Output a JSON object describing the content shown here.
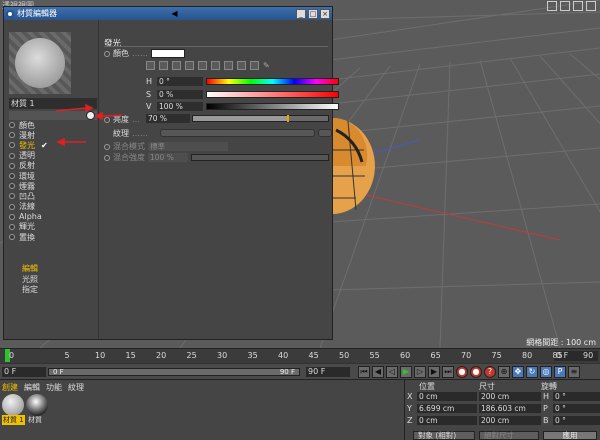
{
  "viewport": {
    "title": "透視視圖",
    "grid_spacing": "網格間距 : 100 cm"
  },
  "material_editor": {
    "title": "材質編輯器",
    "material_name": "材質 1",
    "channels": [
      {
        "label": "顏色",
        "active": false,
        "checked": false
      },
      {
        "label": "漫射",
        "active": false,
        "checked": false
      },
      {
        "label": "發光",
        "active": true,
        "checked": true
      },
      {
        "label": "透明",
        "active": false,
        "checked": false
      },
      {
        "label": "反射",
        "active": false,
        "checked": false
      },
      {
        "label": "環境",
        "active": false,
        "checked": false
      },
      {
        "label": "煙霧",
        "active": false,
        "checked": false
      },
      {
        "label": "凹凸",
        "active": false,
        "checked": false
      },
      {
        "label": "法線",
        "active": false,
        "checked": false
      },
      {
        "label": "Alpha",
        "active": false,
        "checked": false
      },
      {
        "label": "輝光",
        "active": false,
        "checked": false
      },
      {
        "label": "置換",
        "active": false,
        "checked": false
      }
    ],
    "sub_items": [
      {
        "label": "編輯",
        "highlight": true
      },
      {
        "label": "光照",
        "highlight": false
      },
      {
        "label": "指定",
        "highlight": false
      }
    ],
    "section": "發光",
    "color_label": "顏色",
    "color_value": "#ffffff",
    "h_value": "0 °",
    "s_value": "0 %",
    "v_value": "100 %",
    "brightness_label": "亮度",
    "brightness_value": "70 %",
    "brightness_level": 0.7,
    "texture_label": "紋理",
    "blend_mode_label": "混合模式",
    "blend_mode_value": "標準",
    "blend_strength_label": "混合強度",
    "blend_strength_value": "100 %"
  },
  "timeline": {
    "ticks": [
      "0",
      "5",
      "10",
      "15",
      "20",
      "25",
      "30",
      "35",
      "40",
      "45",
      "50",
      "55",
      "60",
      "65",
      "70",
      "75",
      "80",
      "85",
      "90"
    ],
    "current_frame": "0 F"
  },
  "playback": {
    "start": "0 F",
    "range_start": "0 F",
    "range_end": "90 F",
    "end": "90 F"
  },
  "material_manager": {
    "menu": [
      "創建",
      "編輯",
      "功能",
      "紋理"
    ],
    "materials": [
      {
        "label": "材質 1",
        "selected": true
      },
      {
        "label": "材質",
        "selected": false
      }
    ]
  },
  "coordinates": {
    "headers": [
      "位置",
      "尺寸",
      "旋轉"
    ],
    "rows": [
      {
        "axis": "X",
        "pos": "0 cm",
        "size": "200 cm",
        "rot_axis": "H",
        "rot": "0 °"
      },
      {
        "axis": "Y",
        "pos": "6.699 cm",
        "size": "186.603 cm",
        "rot_axis": "P",
        "rot": "0 °"
      },
      {
        "axis": "Z",
        "pos": "0 cm",
        "size": "200 cm",
        "rot_axis": "B",
        "rot": "0 °"
      }
    ],
    "mode": "對象 (相對)",
    "size_mode": "絕對尺寸",
    "apply": "應用"
  },
  "colors": {
    "accent": "#f0c000",
    "titlebar": "#27548e",
    "viewport_bg": "#5b5b5b",
    "play_green": "#2fc22f"
  }
}
